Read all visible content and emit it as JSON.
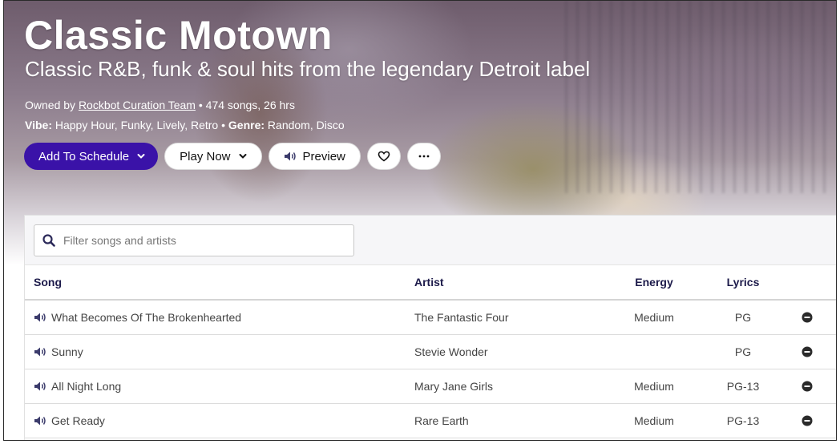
{
  "playlist": {
    "title": "Classic Motown",
    "subtitle": "Classic R&B, funk & soul hits from the legendary Detroit label",
    "owned_by_prefix": "Owned by ",
    "owner": "Rockbot Curation Team",
    "stats": " • 474 songs, 26 hrs",
    "vibe_label": "Vibe:",
    "vibe_value": " Happy Hour, Funky, Lively, Retro • ",
    "genre_label": "Genre:",
    "genre_value": " Random, Disco"
  },
  "actions": {
    "add_to_schedule": "Add To Schedule",
    "play_now": "Play Now",
    "preview": "Preview",
    "favorite_icon": "heart-icon",
    "more_icon": "ellipsis-icon"
  },
  "filter": {
    "placeholder": "Filter songs and artists",
    "value": ""
  },
  "table": {
    "columns": {
      "song": "Song",
      "artist": "Artist",
      "energy": "Energy",
      "lyrics": "Lyrics"
    },
    "rows": [
      {
        "song": "What Becomes Of The Brokenhearted",
        "artist": "The Fantastic Four",
        "energy": "Medium",
        "lyrics": "PG"
      },
      {
        "song": "Sunny",
        "artist": "Stevie Wonder",
        "energy": "",
        "lyrics": "PG"
      },
      {
        "song": "All Night Long",
        "artist": "Mary Jane Girls",
        "energy": "Medium",
        "lyrics": "PG-13"
      },
      {
        "song": "Get Ready",
        "artist": "Rare Earth",
        "energy": "Medium",
        "lyrics": "PG-13"
      }
    ]
  },
  "colors": {
    "primary": "#3a12a8",
    "header_text": "#1c1a4a",
    "icon": "#3c3c6c"
  }
}
